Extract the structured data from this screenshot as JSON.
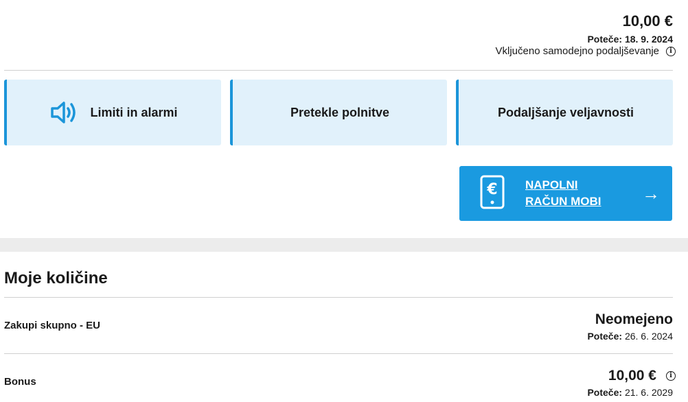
{
  "balance": {
    "amount": "10,00 €",
    "expiry_label": "Poteče:",
    "expiry_date": "18. 9. 2024",
    "autorenew_text": "Vključeno samodejno podaljševanje"
  },
  "tiles": [
    {
      "label": "Limiti in alarmi",
      "icon": "speaker-icon"
    },
    {
      "label": "Pretekle polnitve"
    },
    {
      "label": "Podaljšanje veljavnosti"
    }
  ],
  "cta": {
    "line1": "NAPOLNI",
    "line2": "RAČUN MOBI",
    "icon": "phone-euro-icon",
    "arrow": "→"
  },
  "quantities": {
    "title": "Moje količine",
    "items": [
      {
        "name": "Zakupi skupno - EU",
        "value": "Neomejeno",
        "expiry_label": "Poteče:",
        "expiry_date": "26. 6. 2024"
      },
      {
        "name": "Bonus",
        "value": "10,00 €",
        "expiry_label": "Poteče:",
        "expiry_date": "21. 6. 2029"
      }
    ]
  },
  "colors": {
    "accent": "#1a9ae0",
    "tile_bg": "#e1f1fb"
  }
}
